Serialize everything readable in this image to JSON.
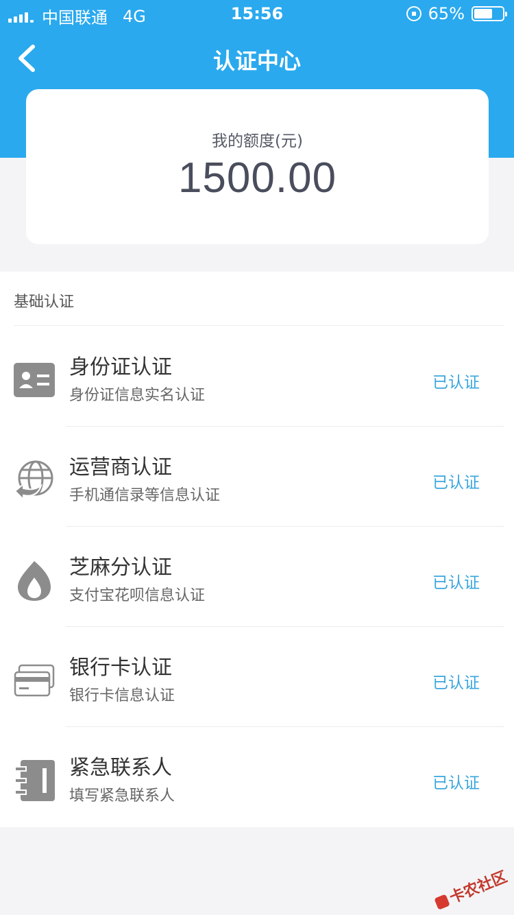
{
  "status_bar": {
    "carrier": "中国联通",
    "network": "4G",
    "time": "15:56",
    "battery_percent_text": "65%",
    "battery_level": 0.65
  },
  "nav": {
    "title": "认证中心"
  },
  "quota": {
    "label": "我的额度(元)",
    "value": "1500.00"
  },
  "section": {
    "title": "基础认证",
    "items": [
      {
        "title": "身份证认证",
        "subtitle": "身份证信息实名认证",
        "status": "已认证",
        "icon": "id-card-icon"
      },
      {
        "title": "运营商认证",
        "subtitle": "手机通信录等信息认证",
        "status": "已认证",
        "icon": "globe-refresh-icon"
      },
      {
        "title": "芝麻分认证",
        "subtitle": "支付宝花呗信息认证",
        "status": "已认证",
        "icon": "sesame-drop-icon"
      },
      {
        "title": "银行卡认证",
        "subtitle": "银行卡信息认证",
        "status": "已认证",
        "icon": "bank-card-icon"
      },
      {
        "title": "紧急联系人",
        "subtitle": "填写紧急联系人",
        "status": "已认证",
        "icon": "contact-book-icon"
      }
    ]
  },
  "watermark": "卡农社区",
  "colors": {
    "header_blue": "#2aa9ee",
    "status_blue": "#39a6dd",
    "icon_gray": "#8c8c8c"
  }
}
